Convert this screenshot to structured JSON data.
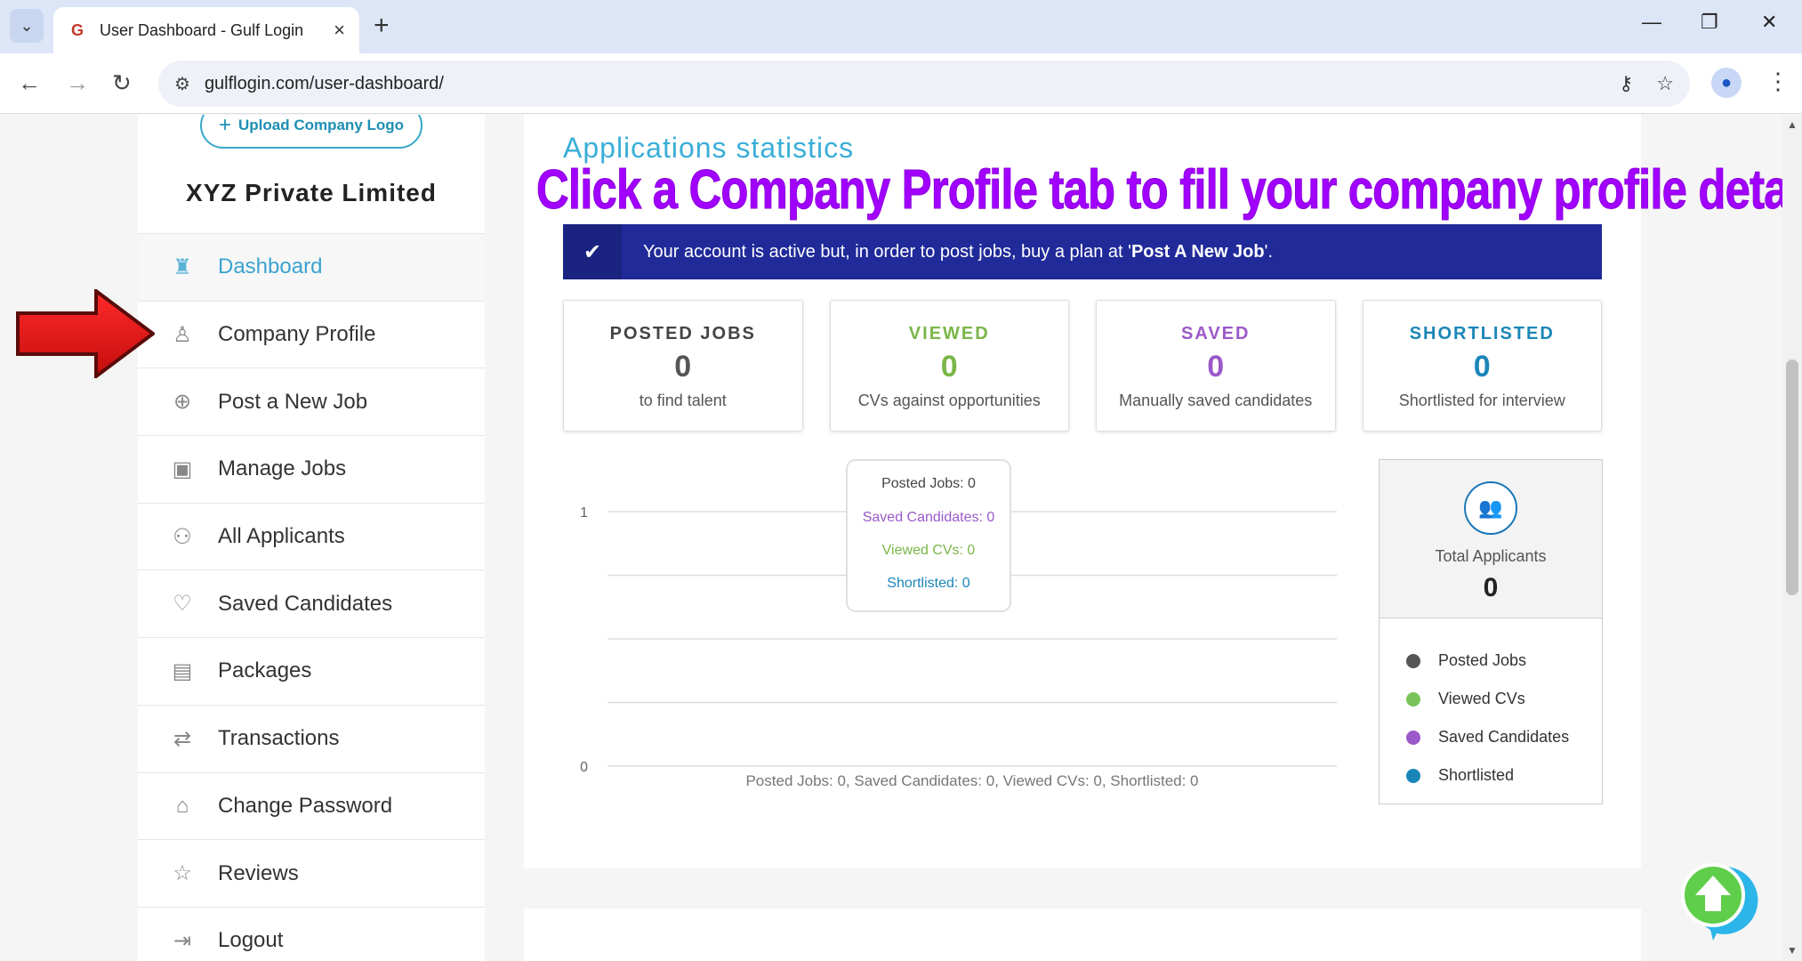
{
  "browser": {
    "tab_title": "User Dashboard - Gulf Login",
    "url": "gulflogin.com/user-dashboard/"
  },
  "sidebar": {
    "upload_label": "Upload Company Logo",
    "company_name": "XYZ Private Limited",
    "items": [
      {
        "label": "Dashboard",
        "icon": "dashboard-icon",
        "active": true
      },
      {
        "label": "Company Profile",
        "icon": "user-icon"
      },
      {
        "label": "Post a New Job",
        "icon": "plus-circle-icon"
      },
      {
        "label": "Manage Jobs",
        "icon": "briefcase-icon"
      },
      {
        "label": "All Applicants",
        "icon": "group-icon"
      },
      {
        "label": "Saved Candidates",
        "icon": "heart-icon"
      },
      {
        "label": "Packages",
        "icon": "card-icon"
      },
      {
        "label": "Transactions",
        "icon": "transactions-icon"
      },
      {
        "label": "Change Password",
        "icon": "lock-icon"
      },
      {
        "label": "Reviews",
        "icon": "star-icon"
      },
      {
        "label": "Logout",
        "icon": "logout-icon"
      }
    ]
  },
  "main": {
    "section_title": "Applications statistics",
    "overlay_note": "Click a Company Profile tab to fill your company profile details",
    "alert": {
      "text_before": "Your account is active but, in order to post jobs, buy a plan at '",
      "link": "Post A New Job",
      "text_after": "'."
    },
    "stats": [
      {
        "title": "POSTED JOBS",
        "value": "0",
        "sub": "to find talent",
        "color": "#555555"
      },
      {
        "title": "VIEWED",
        "value": "0",
        "sub": "CVs against opportunities",
        "color": "#7ab648"
      },
      {
        "title": "SAVED",
        "value": "0",
        "sub": "Manually saved candidates",
        "color": "#9b59c9"
      },
      {
        "title": "SHORTLISTED",
        "value": "0",
        "sub": "Shortlisted for interview",
        "color": "#1a86b8"
      }
    ],
    "tooltip": {
      "posted": "Posted Jobs: 0",
      "saved": "Saved Candidates: 0",
      "viewed": "Viewed CVs: 0",
      "shortlisted": "Shortlisted: 0"
    },
    "legend": {
      "total_label": "Total Applicants",
      "total_value": "0",
      "items": [
        {
          "label": "Posted Jobs",
          "color": "#555555"
        },
        {
          "label": "Viewed CVs",
          "color": "#7ac35a"
        },
        {
          "label": "Saved Candidates",
          "color": "#9b59c9"
        },
        {
          "label": "Shortlisted",
          "color": "#1a86b8"
        }
      ]
    }
  },
  "chart_data": {
    "type": "line",
    "categories": [
      ""
    ],
    "series": [
      {
        "name": "Posted Jobs",
        "values": [
          0
        ]
      },
      {
        "name": "Saved Candidates",
        "values": [
          0
        ]
      },
      {
        "name": "Viewed CVs",
        "values": [
          0
        ]
      },
      {
        "name": "Shortlisted",
        "values": [
          0
        ]
      }
    ],
    "yticks": [
      "0",
      "1"
    ],
    "ylim": [
      0,
      1
    ],
    "grid": true,
    "xlabel": "Posted Jobs: 0, Saved Candidates: 0, Viewed CVs: 0, Shortlisted: 0"
  }
}
